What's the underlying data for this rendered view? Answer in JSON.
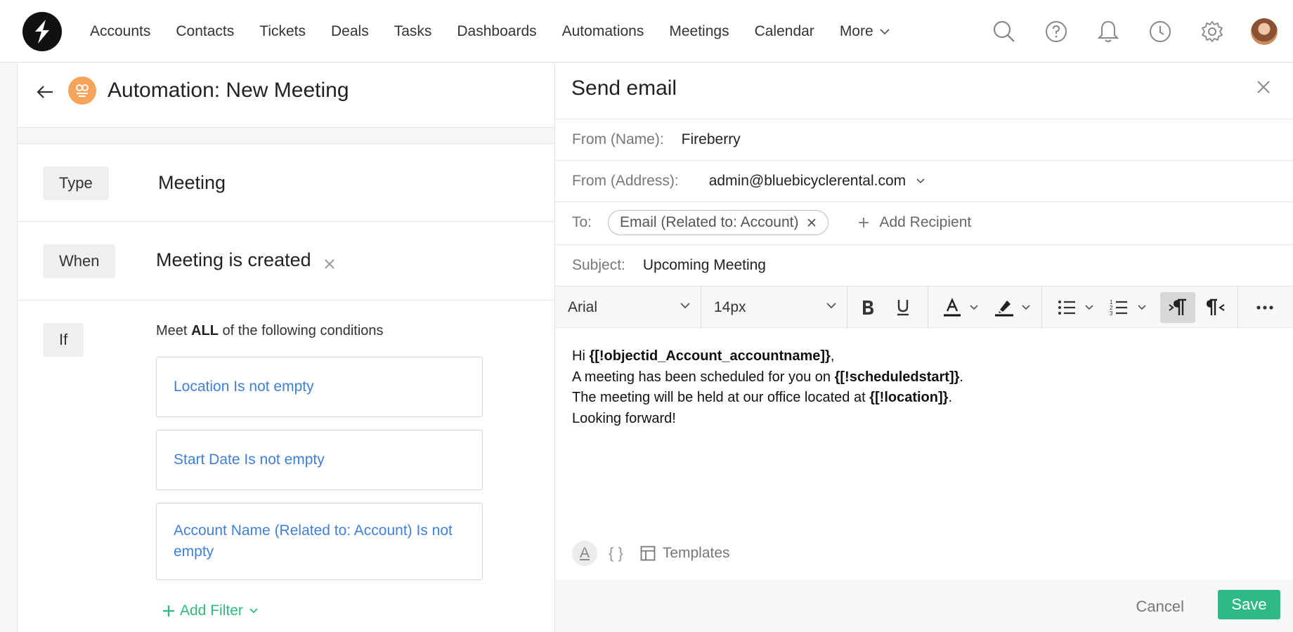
{
  "nav": {
    "items": [
      "Accounts",
      "Contacts",
      "Tickets",
      "Deals",
      "Tasks",
      "Dashboards",
      "Automations",
      "Meetings",
      "Calendar"
    ],
    "more_label": "More"
  },
  "automation": {
    "title": "Automation: New Meeting",
    "type_tag": "Type",
    "type_value": "Meeting",
    "when_tag": "When",
    "when_value": "Meeting is created",
    "if_tag": "If",
    "conditions_prefix": "Meet ",
    "conditions_bold": "ALL",
    "conditions_suffix": " of the following conditions",
    "conditions": [
      "Location Is not empty",
      "Start Date Is not empty",
      "Account Name (Related to: Account) Is not empty"
    ],
    "add_filter_label": "Add Filter"
  },
  "email": {
    "title": "Send email",
    "from_name_label": "From (Name):",
    "from_name_value": "Fireberry",
    "from_address_label": "From (Address):",
    "from_address_value": "admin@bluebicyclerental.com",
    "to_label": "To:",
    "to_chip": "Email (Related to: Account)",
    "add_recipient_label": "Add Recipient",
    "subject_label": "Subject:",
    "subject_value": "Upcoming Meeting",
    "toolbar": {
      "font": "Arial",
      "size": "14px"
    },
    "body": {
      "line1_prefix": "Hi ",
      "line1_token": "{[!objectid_Account_accountname]}",
      "line1_suffix": ",",
      "line2_prefix": "A meeting has been scheduled for you on ",
      "line2_token": "{[!scheduledstart]}",
      "line2_suffix": ".",
      "line3_prefix": "The meeting will be held at our office located at ",
      "line3_token": "{[!location]}",
      "line3_suffix": ".",
      "line4": "Looking forward!"
    },
    "footer": {
      "text_format_glyph": "A",
      "braces_glyph": "{ }",
      "templates_label": "Templates",
      "cancel_label": "Cancel",
      "save_label": "Save"
    }
  },
  "colors": {
    "accent_green": "#2fb985",
    "link_blue": "#3f7fd8",
    "automation_orange": "#f6a45a"
  }
}
